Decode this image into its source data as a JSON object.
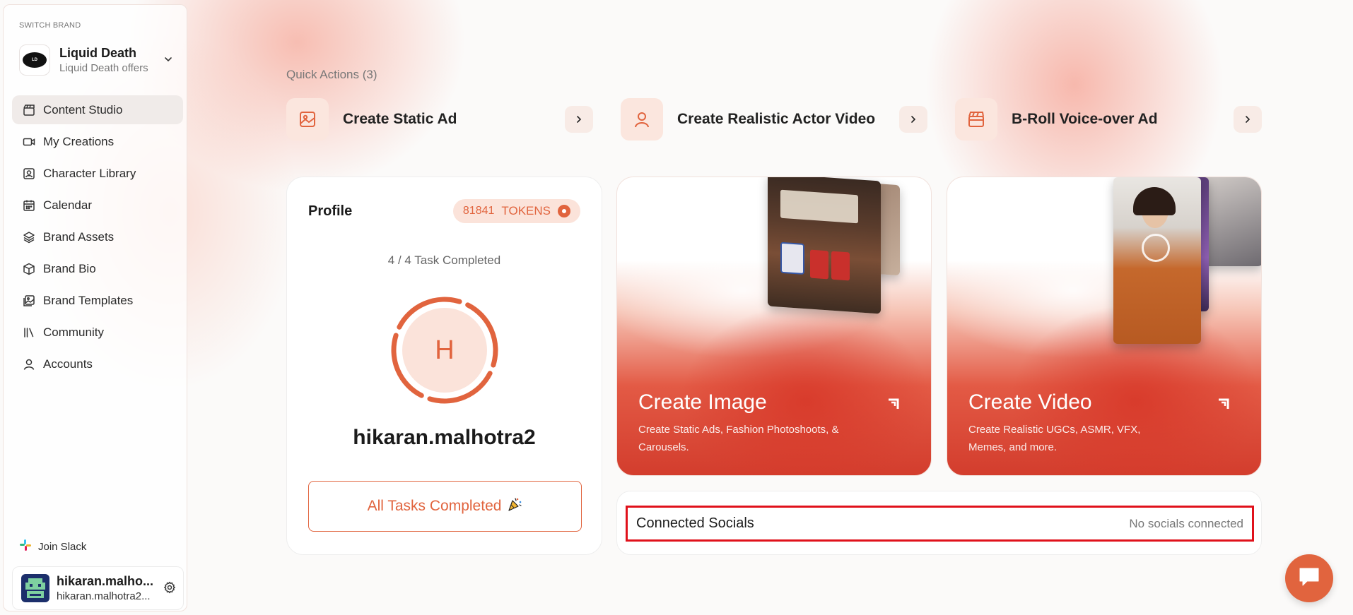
{
  "sidebar": {
    "switch_label": "SWITCH BRAND",
    "brand": {
      "name": "Liquid Death",
      "sub": "Liquid Death offers"
    },
    "items": [
      {
        "label": "Content Studio",
        "icon": "clapperboard-icon",
        "active": true
      },
      {
        "label": "My Creations",
        "icon": "video-camera-icon"
      },
      {
        "label": "Character Library",
        "icon": "portrait-icon"
      },
      {
        "label": "Calendar",
        "icon": "calendar-icon"
      },
      {
        "label": "Brand Assets",
        "icon": "layers-icon"
      },
      {
        "label": "Brand Bio",
        "icon": "box-icon"
      },
      {
        "label": "Brand Templates",
        "icon": "image-stack-icon"
      },
      {
        "label": "Community",
        "icon": "library-icon"
      },
      {
        "label": "Accounts",
        "icon": "user-icon"
      }
    ],
    "join_slack": "Join Slack",
    "user": {
      "name": "hikaran.malho...",
      "email": "hikaran.malhotra2..."
    }
  },
  "quick_actions": {
    "title": "Quick Actions (3)",
    "items": [
      {
        "label": "Create Static Ad",
        "icon": "image-icon"
      },
      {
        "label": "Create Realistic Actor Video",
        "icon": "person-icon"
      },
      {
        "label": "B-Roll Voice-over Ad",
        "icon": "clapperboard-icon"
      }
    ]
  },
  "profile": {
    "title": "Profile",
    "tokens_count": "81841",
    "tokens_label": "TOKENS",
    "task_status": "4 / 4 Task Completed",
    "tasks_done": 4,
    "tasks_total": 4,
    "avatar_letter": "H",
    "username": "hikaran.malhotra2",
    "all_tasks_label": "All Tasks Completed",
    "party_emoji": "🎉"
  },
  "create_image": {
    "title": "Create Image",
    "desc": "Create Static Ads, Fashion Photoshoots, & Carousels."
  },
  "create_video": {
    "title": "Create Video",
    "desc": "Create Realistic UGCs, ASMR, VFX, Memes, and more."
  },
  "socials": {
    "title": "Connected Socials",
    "status": "No socials connected"
  },
  "colors": {
    "accent": "#e1643e",
    "accent_light": "#fbe3da",
    "highlight_border": "#e0111b"
  }
}
